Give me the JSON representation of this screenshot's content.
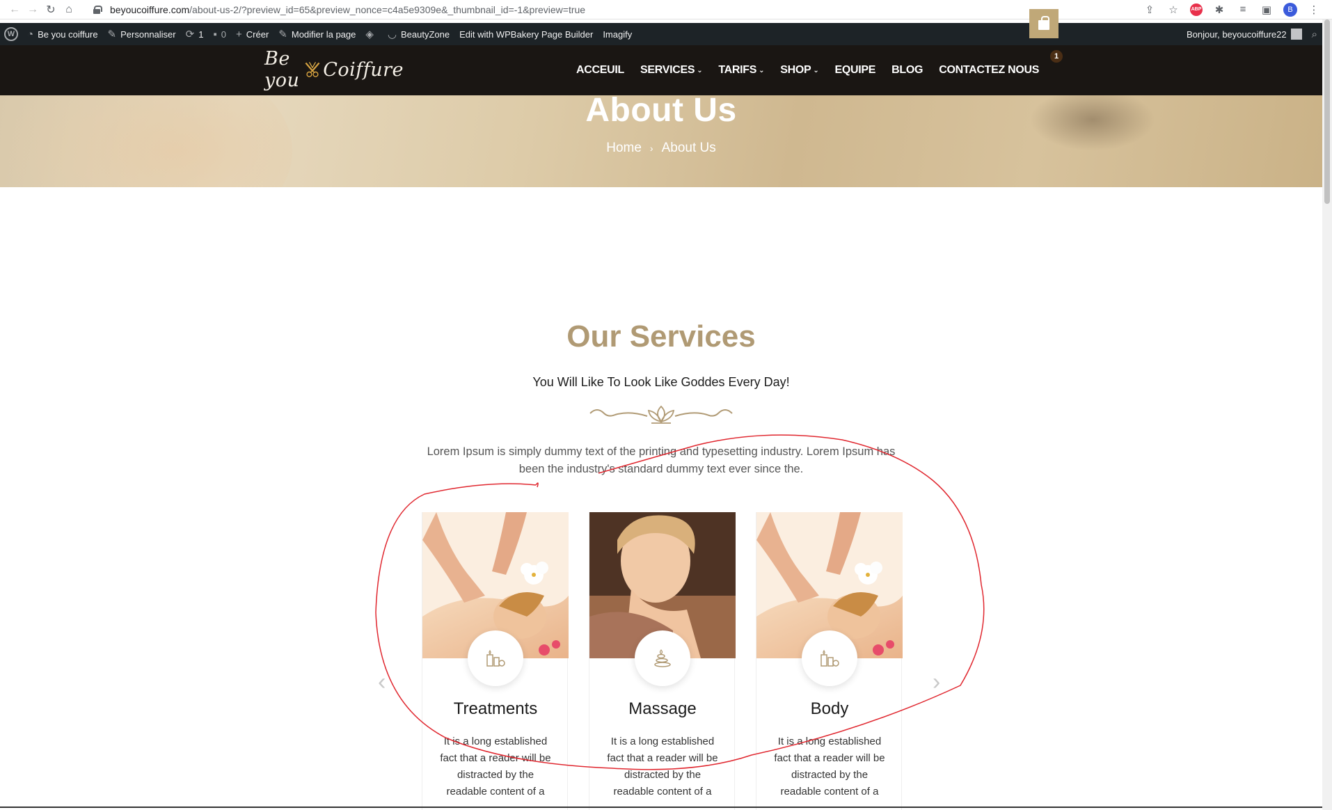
{
  "browser": {
    "url_host": "beyoucoiffure.com",
    "url_rest": "/about-us-2/?preview_id=65&preview_nonce=c4a5e9309e&_thumbnail_id=-1&preview=true",
    "back_icon": "back-arrow-icon",
    "forward_icon": "forward-arrow-icon",
    "reload_icon": "reload-icon",
    "home_icon": "home-icon",
    "abp_label": "ABP",
    "profile_initial": "B"
  },
  "admin_bar": {
    "site_name": "Be you coiffure",
    "customize": "Personnaliser",
    "updates_count": "1",
    "comments_count": "0",
    "new_label": "Créer",
    "edit_page": "Modifier la page",
    "theme": "BeautyZone",
    "wpbakery": "Edit with WPBakery Page Builder",
    "imagify": "Imagify",
    "greeting": "Bonjour, beyoucoiffure22"
  },
  "header": {
    "logo_left": "Be you",
    "logo_right": "Coiffure",
    "nav": [
      {
        "label": "ACCEUIL",
        "caret": false
      },
      {
        "label": "SERVICES",
        "caret": true
      },
      {
        "label": "TARIFS",
        "caret": true
      },
      {
        "label": "SHOP",
        "caret": true
      },
      {
        "label": "EQUIPE",
        "caret": false
      },
      {
        "label": "BLOG",
        "caret": false
      },
      {
        "label": "CONTACTEZ NOUS",
        "caret": false
      }
    ],
    "cart_count": "1",
    "accent_color": "#c0a878"
  },
  "hero": {
    "title": "About Us",
    "breadcrumb_home": "Home",
    "breadcrumb_sep": "›",
    "breadcrumb_current": "About Us"
  },
  "services": {
    "title": "Our Services",
    "subtitle": "You Will Like To Look Like Goddes Every Day!",
    "description": "Lorem Ipsum is simply dummy text of the printing and typesetting industry. Lorem Ipsum has been the industry's standard dummy text ever since the.",
    "title_color": "#b09a74",
    "cards": [
      {
        "title": "Treatments",
        "text": "It is a long established fact that a reader will be distracted by the readable content of a",
        "icon": "candles-spa-icon"
      },
      {
        "title": "Massage",
        "text": "It is a long established fact that a reader will be distracted by the readable content of a",
        "icon": "stones-spa-icon"
      },
      {
        "title": "Body",
        "text": "It is a long established fact that a reader will be distracted by the readable content of a",
        "icon": "candles-spa-icon"
      }
    ],
    "prev_arrow": "‹",
    "next_arrow": "›"
  }
}
